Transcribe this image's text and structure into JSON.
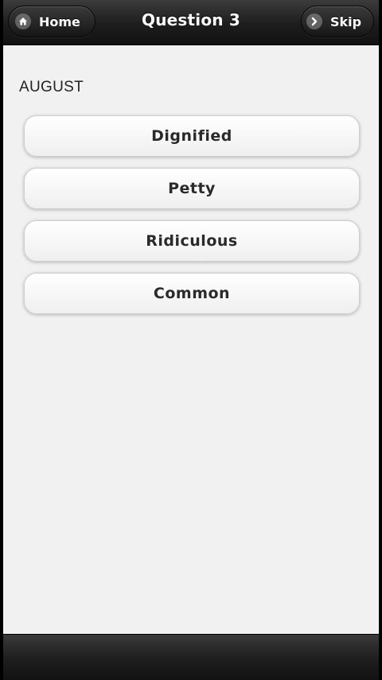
{
  "header": {
    "title": "Question 3",
    "home_label": "Home",
    "skip_label": "Skip",
    "home_icon": "home-icon",
    "skip_icon": "chevron-right-icon"
  },
  "question": {
    "word": "AUGUST",
    "options": [
      {
        "label": "Dignified"
      },
      {
        "label": "Petty"
      },
      {
        "label": "Ridiculous"
      },
      {
        "label": "Common"
      }
    ]
  },
  "colors": {
    "header_bg": "#1d1d1d",
    "content_bg": "#f1f1f1",
    "option_text": "#2a2a2a"
  }
}
